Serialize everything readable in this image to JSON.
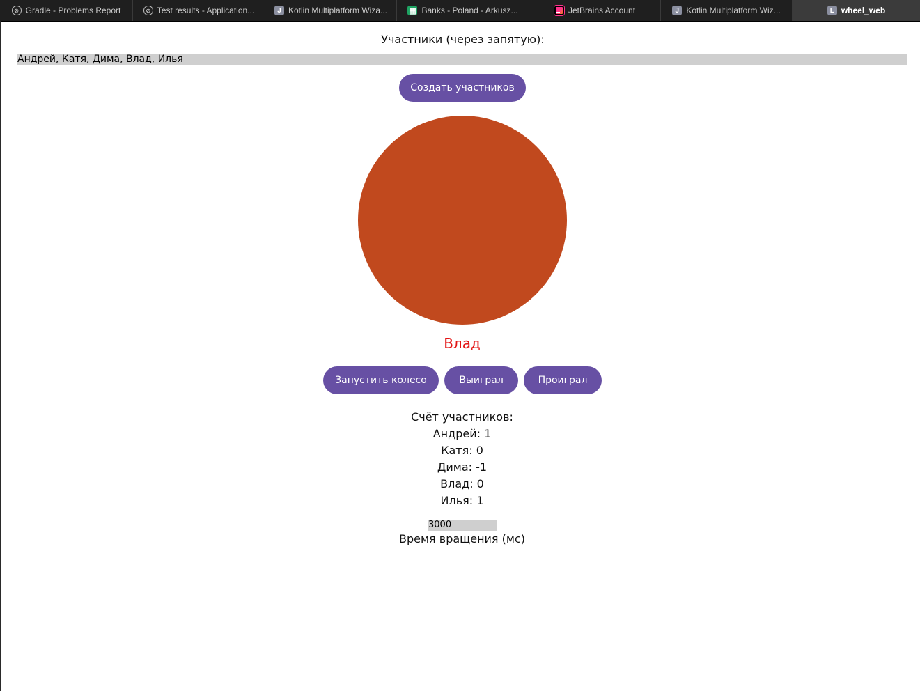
{
  "browser": {
    "tabs": [
      {
        "title": "Gradle - Problems Report",
        "icon": "compass-icon",
        "glyph": "⊘",
        "active": false
      },
      {
        "title": "Test results - Application...",
        "icon": "compass-icon",
        "glyph": "⊘",
        "active": false
      },
      {
        "title": "Kotlin Multiplatform Wiza...",
        "icon": "letter-j-icon",
        "glyph": "J",
        "active": false
      },
      {
        "title": "Banks - Poland - Arkusz...",
        "icon": "sheets-icon",
        "glyph": "▦",
        "active": false
      },
      {
        "title": "JetBrains Account",
        "icon": "jetbrains-icon",
        "glyph": "",
        "active": false
      },
      {
        "title": "Kotlin Multiplatform Wiz...",
        "icon": "letter-j-icon",
        "glyph": "J",
        "active": false
      },
      {
        "title": "wheel_web",
        "icon": "letter-l-icon",
        "glyph": "L",
        "active": true
      }
    ]
  },
  "app": {
    "participants_label": "Участники (через запятую):",
    "participants_value": "Андрей, Катя, Дима, Влад, Илья",
    "create_button": "Создать участников",
    "wheel_color": "#c1491e",
    "winner_name": "Влад",
    "winner_color": "#e31414",
    "spin_button": "Запустить колесо",
    "won_button": "Выиграл",
    "lost_button": "Проиграл",
    "button_color": "#6750a4",
    "scores_title": "Счёт участников:",
    "scores": [
      "Андрей: 1",
      "Катя: 0",
      "Дима: -1",
      "Влад: 0",
      "Илья: 1"
    ],
    "duration_value": "3000",
    "duration_label": "Время вращения (мс)"
  }
}
